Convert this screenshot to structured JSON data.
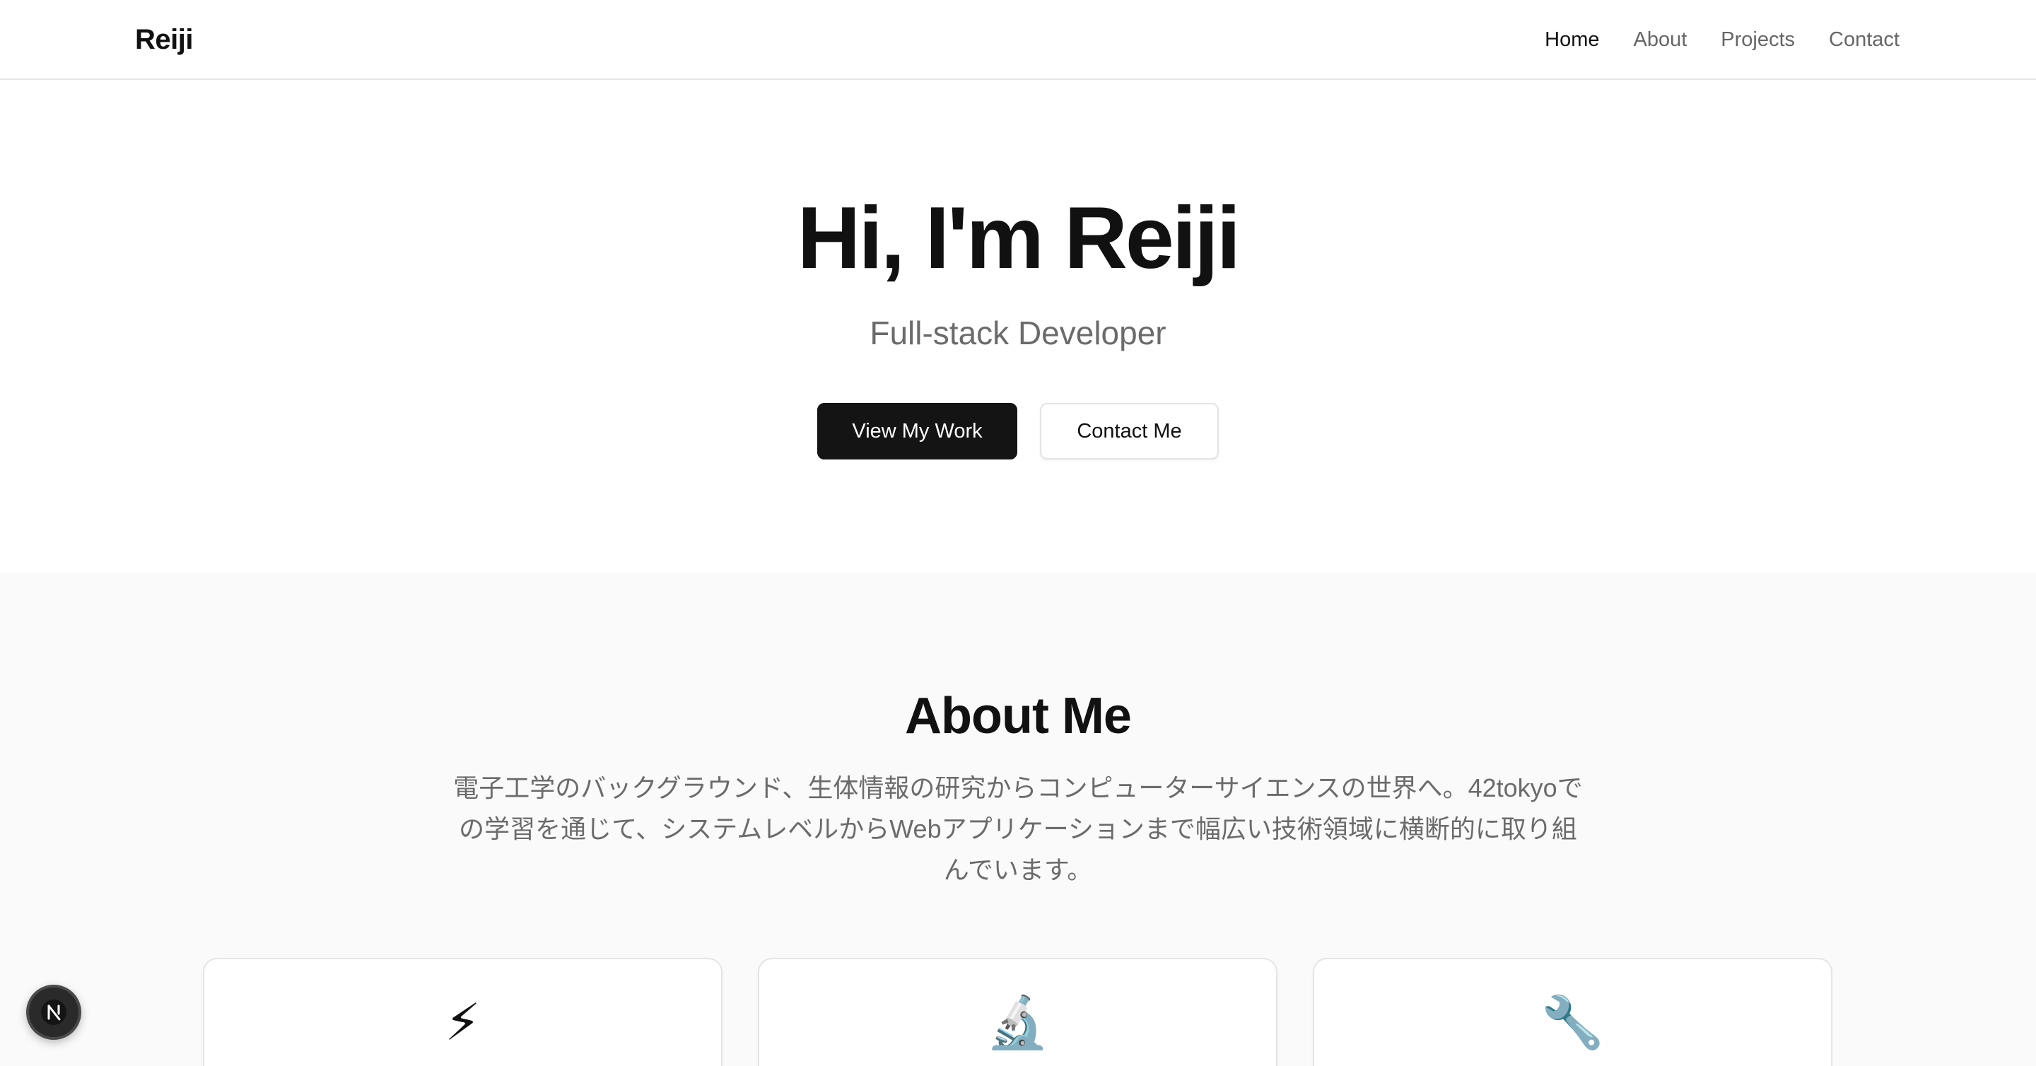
{
  "header": {
    "logo": "Reiji",
    "nav": [
      {
        "label": "Home",
        "active": true
      },
      {
        "label": "About",
        "active": false
      },
      {
        "label": "Projects",
        "active": false
      },
      {
        "label": "Contact",
        "active": false
      }
    ]
  },
  "hero": {
    "title": "Hi, I'm Reiji",
    "subtitle": "Full-stack Developer",
    "primary_button": "View My Work",
    "secondary_button": "Contact Me"
  },
  "about": {
    "title": "About Me",
    "description": "電子工学のバックグラウンド、生体情報の研究からコンピューターサイエンスの世界へ。42tokyoでの学習を通じて、システムレベルからWebアプリケーションまで幅広い技術領域に横断的に取り組んでいます。",
    "cards": [
      {
        "icon": "⚡",
        "icon_name": "lightning-icon"
      },
      {
        "icon": "🔬",
        "icon_name": "microscope-icon"
      },
      {
        "icon": "🔧",
        "icon_name": "wrench-icon"
      }
    ]
  },
  "dev_badge": {
    "icon_name": "nextjs-icon",
    "letter": "N"
  },
  "colors": {
    "primary": "#141414",
    "muted_text": "#6b6b6b",
    "section_bg": "#fafafa",
    "border": "#e5e5e5"
  }
}
